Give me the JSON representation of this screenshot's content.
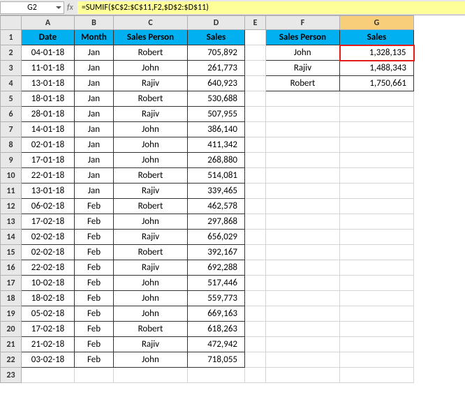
{
  "nameBox": "G2",
  "fx": "fx",
  "formula": "=SUMIF($C$2:$C$11,F2,$D$2:$D$11)",
  "cols": [
    "A",
    "B",
    "C",
    "D",
    "E",
    "F",
    "G"
  ],
  "activeCol": "G",
  "rowNums": [
    "1",
    "2",
    "3",
    "4",
    "5",
    "6",
    "7",
    "8",
    "9",
    "10",
    "11",
    "12",
    "13",
    "14",
    "15",
    "16",
    "17",
    "18",
    "19",
    "20",
    "21",
    "22",
    "23"
  ],
  "h": {
    "date": "Date",
    "month": "Month",
    "person": "Sales Person",
    "sales": "Sales",
    "sperson": "Sales Person",
    "ssales": "Sales"
  },
  "rows": [
    {
      "d": "04-01-18",
      "m": "Jan",
      "p": "Robert",
      "s": "705,892"
    },
    {
      "d": "11-01-18",
      "m": "Jan",
      "p": "John",
      "s": "261,773"
    },
    {
      "d": "13-01-18",
      "m": "Jan",
      "p": "Rajiv",
      "s": "640,923"
    },
    {
      "d": "18-01-18",
      "m": "Jan",
      "p": "Robert",
      "s": "530,688"
    },
    {
      "d": "28-01-18",
      "m": "Jan",
      "p": "Rajiv",
      "s": "507,955"
    },
    {
      "d": "14-01-18",
      "m": "Jan",
      "p": "John",
      "s": "386,140"
    },
    {
      "d": "02-01-18",
      "m": "Jan",
      "p": "John",
      "s": "411,342"
    },
    {
      "d": "17-01-18",
      "m": "Jan",
      "p": "John",
      "s": "268,880"
    },
    {
      "d": "22-01-18",
      "m": "Jan",
      "p": "Robert",
      "s": "514,081"
    },
    {
      "d": "13-01-18",
      "m": "Jan",
      "p": "Rajiv",
      "s": "339,465"
    },
    {
      "d": "06-02-18",
      "m": "Feb",
      "p": "Robert",
      "s": "462,578"
    },
    {
      "d": "17-02-18",
      "m": "Feb",
      "p": "John",
      "s": "297,868"
    },
    {
      "d": "02-02-18",
      "m": "Feb",
      "p": "Rajiv",
      "s": "656,029"
    },
    {
      "d": "02-02-18",
      "m": "Feb",
      "p": "Robert",
      "s": "392,167"
    },
    {
      "d": "22-02-18",
      "m": "Feb",
      "p": "Rajiv",
      "s": "692,288"
    },
    {
      "d": "10-02-18",
      "m": "Feb",
      "p": "John",
      "s": "517,446"
    },
    {
      "d": "18-02-18",
      "m": "Feb",
      "p": "John",
      "s": "559,773"
    },
    {
      "d": "05-02-18",
      "m": "Feb",
      "p": "John",
      "s": "669,163"
    },
    {
      "d": "17-02-18",
      "m": "Feb",
      "p": "Robert",
      "s": "618,263"
    },
    {
      "d": "21-02-18",
      "m": "Feb",
      "p": "Rajiv",
      "s": "472,942"
    },
    {
      "d": "03-02-18",
      "m": "Feb",
      "p": "John",
      "s": "718,055"
    }
  ],
  "summary": [
    {
      "p": "John",
      "s": "1,328,135"
    },
    {
      "p": "Rajiv",
      "s": "1,488,343"
    },
    {
      "p": "Robert",
      "s": "1,750,661"
    }
  ]
}
